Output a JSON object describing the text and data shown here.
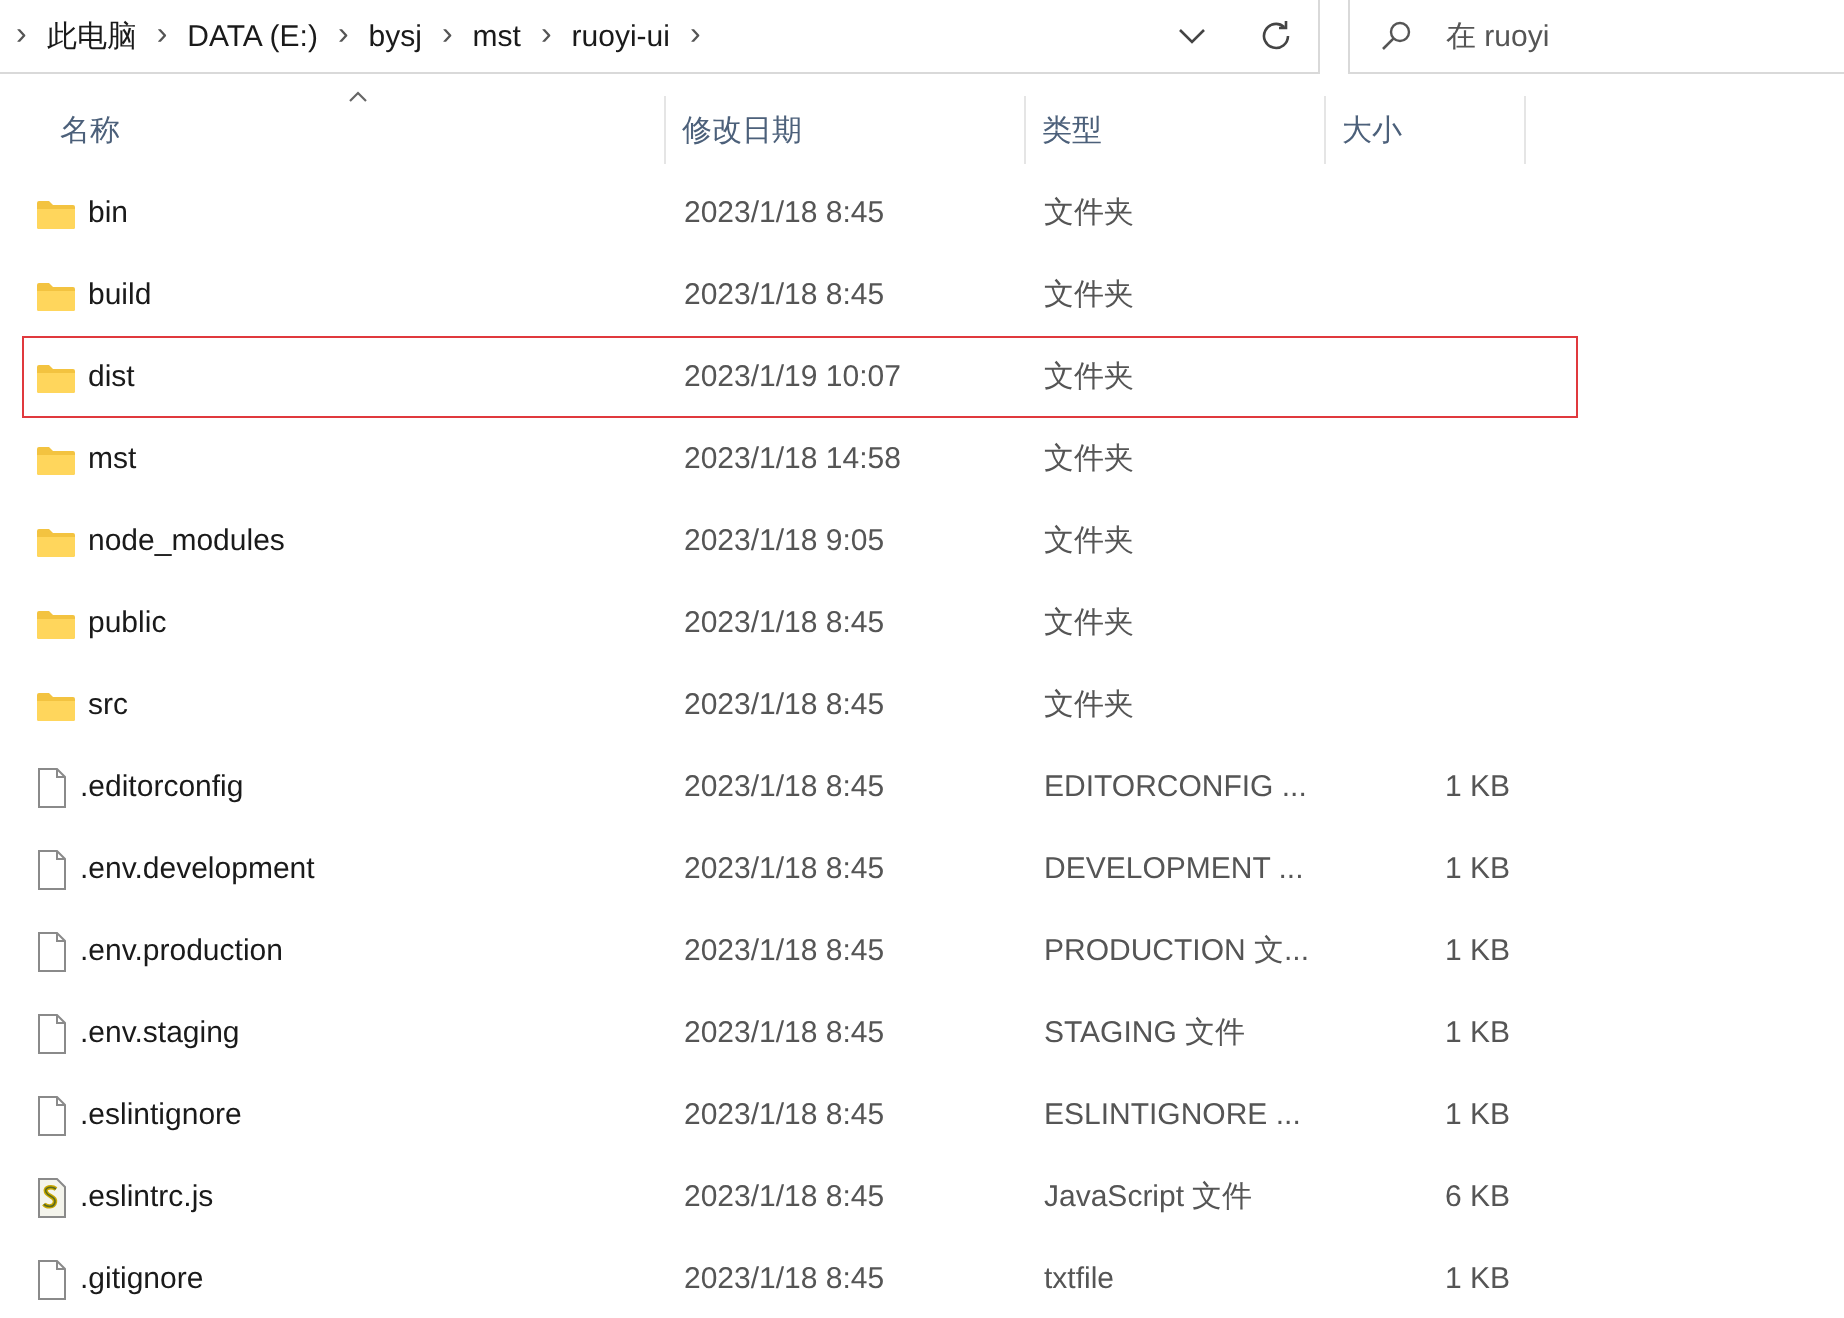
{
  "address_bar": {
    "separator": "›",
    "breadcrumbs": [
      "此电脑",
      "DATA (E:)",
      "bysj",
      "mst",
      "ruoyi-ui"
    ]
  },
  "search": {
    "placeholder": "在 ruoyi"
  },
  "table": {
    "columns": [
      {
        "label": "名称",
        "sorted": true
      },
      {
        "label": "修改日期",
        "sorted": false
      },
      {
        "label": "类型",
        "sorted": false
      },
      {
        "label": "大小",
        "sorted": false
      }
    ],
    "rows": [
      {
        "kind": "folder",
        "name": "bin",
        "modified": "2023/1/18 8:45",
        "type": "文件夹",
        "highlighted": false
      },
      {
        "kind": "folder",
        "name": "build",
        "modified": "2023/1/18 8:45",
        "type": "文件夹",
        "highlighted": false
      },
      {
        "kind": "folder",
        "name": "dist",
        "modified": "2023/1/19 10:07",
        "type": "文件夹",
        "highlighted": true
      },
      {
        "kind": "folder",
        "name": "mst",
        "modified": "2023/1/18 14:58",
        "type": "文件夹",
        "highlighted": false
      },
      {
        "kind": "folder",
        "name": "node_modules",
        "modified": "2023/1/18 9:05",
        "type": "文件夹",
        "highlighted": false
      },
      {
        "kind": "folder",
        "name": "public",
        "modified": "2023/1/18 8:45",
        "type": "文件夹",
        "highlighted": false
      },
      {
        "kind": "folder",
        "name": "src",
        "modified": "2023/1/18 8:45",
        "type": "文件夹",
        "highlighted": false
      },
      {
        "kind": "file",
        "name": ".editorconfig",
        "modified": "2023/1/18 8:45",
        "type": "EDITORCONFIG ...",
        "size": "1 KB",
        "highlighted": false
      },
      {
        "kind": "file",
        "name": ".env.development",
        "modified": "2023/1/18 8:45",
        "type": "DEVELOPMENT ...",
        "size": "1 KB",
        "highlighted": false
      },
      {
        "kind": "file",
        "name": ".env.production",
        "modified": "2023/1/18 8:45",
        "type": "PRODUCTION 文...",
        "size": "1 KB",
        "highlighted": false
      },
      {
        "kind": "file",
        "name": ".env.staging",
        "modified": "2023/1/18 8:45",
        "type": "STAGING 文件",
        "size": "1 KB",
        "highlighted": false
      },
      {
        "kind": "file",
        "name": ".eslintignore",
        "modified": "2023/1/18 8:45",
        "type": "ESLINTIGNORE ...",
        "size": "1 KB",
        "highlighted": false
      },
      {
        "kind": "script",
        "name": ".eslintrc.js",
        "modified": "2023/1/18 8:45",
        "type": "JavaScript 文件",
        "size": "6 KB",
        "highlighted": false
      },
      {
        "kind": "file",
        "name": ".gitignore",
        "modified": "2023/1/18 8:45",
        "type": "txtfile",
        "size": "1 KB",
        "highlighted": false
      }
    ]
  }
}
